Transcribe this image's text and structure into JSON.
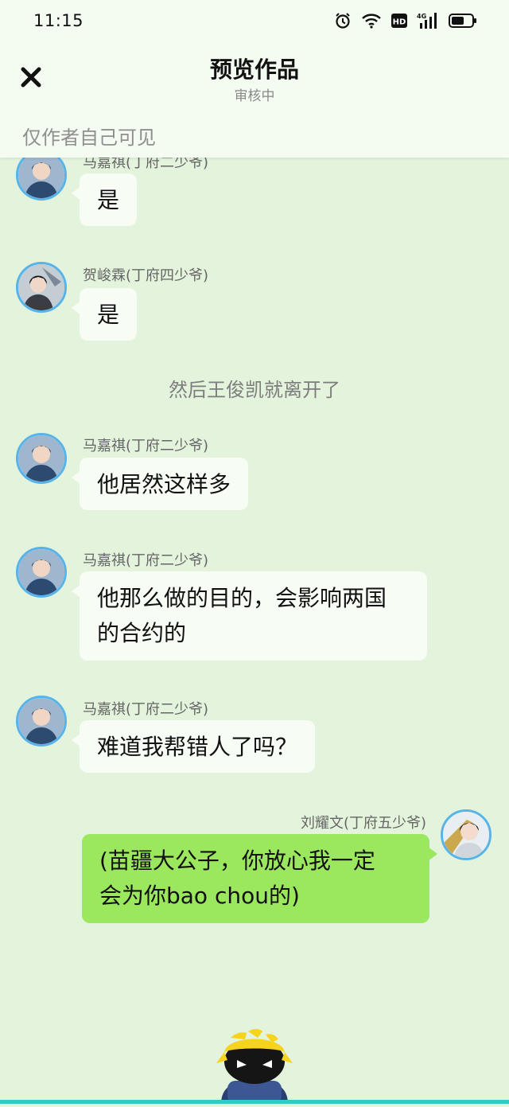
{
  "status_bar": {
    "time": "11:15",
    "icons": [
      "alarm-icon",
      "wifi-icon",
      "hd-icon",
      "signal-4g-icon",
      "battery-icon"
    ]
  },
  "header": {
    "title": "预览作品",
    "subtitle": "审核中",
    "close_icon": "close-icon"
  },
  "visibility_note": "仅作者自己可见",
  "messages": [
    {
      "sender": "马嘉祺(丁府二少爷)",
      "text": "是"
    },
    {
      "sender": "贺峻霖(丁府四少爷)",
      "text": "是"
    },
    {
      "narration": "然后王俊凯就离开了"
    },
    {
      "sender": "马嘉祺(丁府二少爷)",
      "text": "他居然这样多"
    },
    {
      "sender": "马嘉祺(丁府二少爷)",
      "text_line1": "他那么做的目的，会影响两国",
      "text_line2": "的合约的"
    },
    {
      "sender": "马嘉祺(丁府二少爷)",
      "text": "难道我帮错人了吗？"
    },
    {
      "sender": "刘耀文(丁府五少爷)",
      "text_line1": "(苗疆大公子，你放心我一定",
      "text_line2": "会为你bao chou的)",
      "self": true
    }
  ],
  "colors": {
    "background": "#e3f3dc",
    "self_bubble": "#9be75e",
    "other_bubble": "#f7fcf5",
    "avatar_border": "#57b4ea"
  }
}
